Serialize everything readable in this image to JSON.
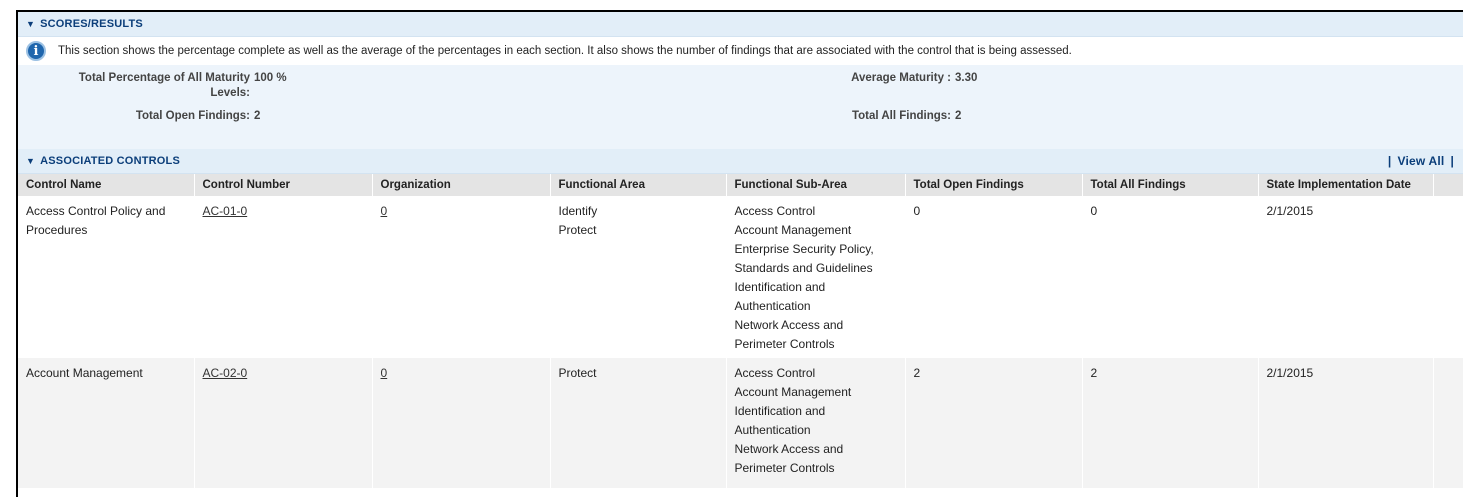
{
  "scores": {
    "title": "SCORES/RESULTS",
    "info_text": "This section shows the percentage complete as well as the average of the percentages in each section. It also shows the number of findings that are associated with the control that is being assessed.",
    "total_pct_label_line1": "Total Percentage of All Maturity",
    "total_pct_label_line2": "Levels:",
    "total_pct_value": "100 %",
    "avg_maturity_label": "Average Maturity :",
    "avg_maturity_value": "3.30",
    "open_findings_label": "Total Open Findings:",
    "open_findings_value": "2",
    "all_findings_label": "Total All Findings:",
    "all_findings_value": "2"
  },
  "controls": {
    "title": "ASSOCIATED CONTROLS",
    "view_all_label": "View All",
    "columns": [
      "Control Name",
      "Control Number",
      "Organization",
      "Functional Area",
      "Functional Sub-Area",
      "Total Open Findings",
      "Total All Findings",
      "State Implementation Date"
    ],
    "rows": [
      {
        "name": "Access Control Policy and Procedures",
        "number": "AC-01-0",
        "organization": "0",
        "functional_area": [
          "Identify",
          "Protect"
        ],
        "sub_area": [
          "Access Control",
          "Account Management",
          "Enterprise Security Policy, Standards and Guidelines",
          "Identification and Authentication",
          "Network Access and Perimeter Controls"
        ],
        "open_findings": "0",
        "all_findings": "0",
        "impl_date": "2/1/2015"
      },
      {
        "name": "Account Management",
        "number": "AC-02-0",
        "organization": "0",
        "functional_area": [
          "Protect"
        ],
        "sub_area": [
          "Access Control",
          "Account Management",
          "Identification and Authentication",
          "Network Access and Perimeter Controls"
        ],
        "open_findings": "2",
        "all_findings": "2",
        "impl_date": "2/1/2015"
      }
    ]
  }
}
